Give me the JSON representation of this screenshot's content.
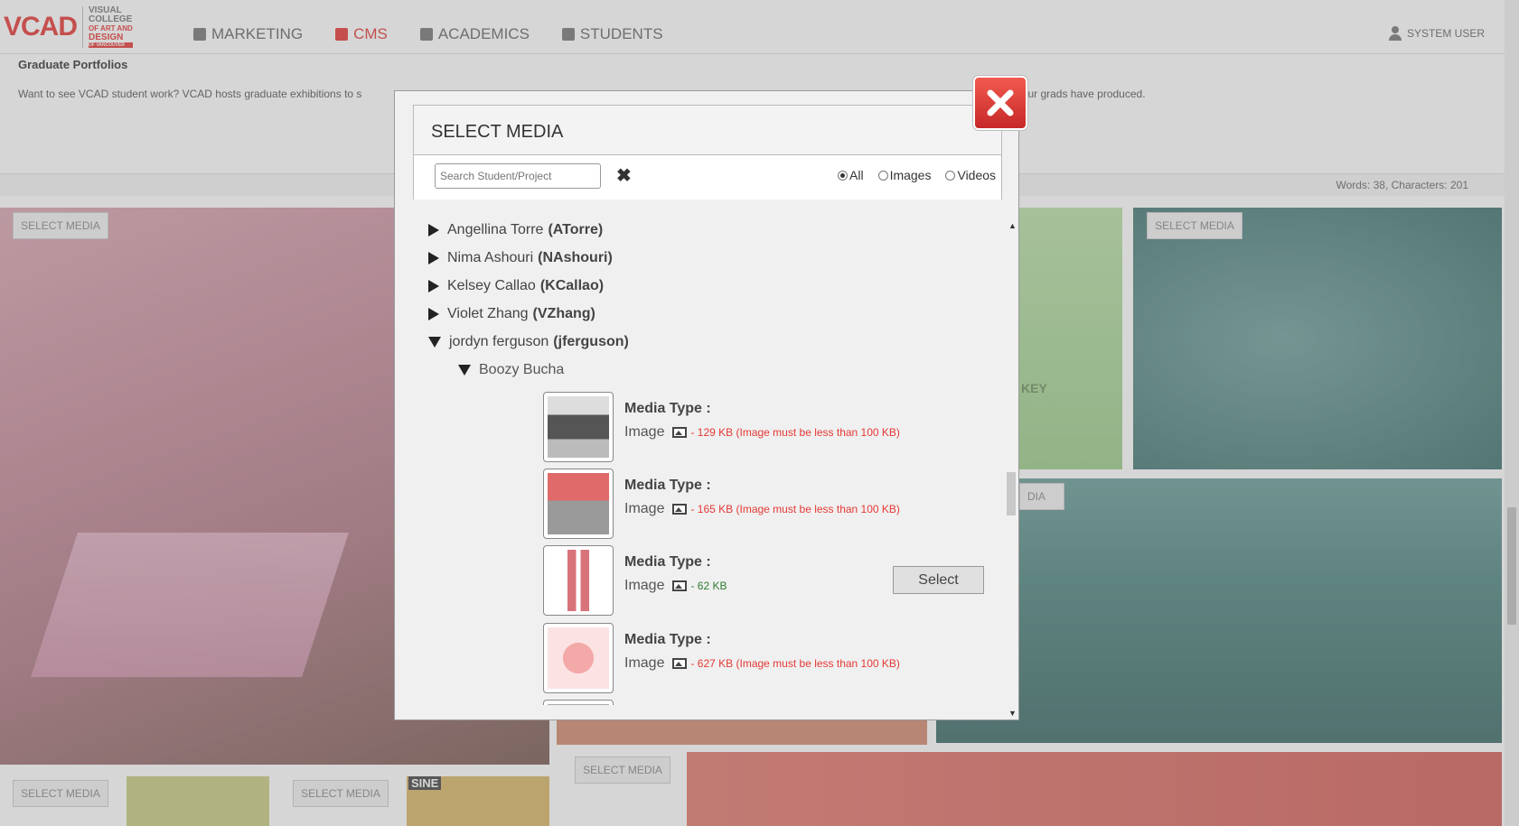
{
  "brand": {
    "mark": "VCAD",
    "lines": [
      "VISUAL",
      "COLLEGE",
      "OF ART AND",
      "DESIGN",
      "OF VANCOUVER"
    ]
  },
  "nav": [
    {
      "label": "MARKETING",
      "icon": "bar-chart-icon",
      "active": false
    },
    {
      "label": "CMS",
      "icon": "edit-icon",
      "active": true
    },
    {
      "label": "ACADEMICS",
      "icon": "classroom-icon",
      "active": false
    },
    {
      "label": "STUDENTS",
      "icon": "graduate-icon",
      "active": false
    }
  ],
  "user": {
    "label": "SYSTEM USER",
    "icon": "user-icon"
  },
  "page": {
    "section_title": "Graduate Portfolios",
    "description_left": "Want to see VCAD student work? VCAD hosts graduate exhibitions to s",
    "description_right": "work our grads have produced.",
    "word_count": "Words: 38, Characters: 201",
    "select_media_label": "SELECT MEDIA",
    "tile_labels": {
      "key_fragment": "KEY",
      "sine_fragment": "SINE",
      "dia_fragment": "DIA"
    }
  },
  "modal": {
    "title": "SELECT MEDIA",
    "search": {
      "placeholder": "Search Student/Project",
      "value": ""
    },
    "filters": [
      {
        "label": "All",
        "checked": true
      },
      {
        "label": "Images",
        "checked": false
      },
      {
        "label": "Videos",
        "checked": false
      }
    ],
    "students": [
      {
        "name": "Angellina Torre",
        "id": "(ATorre)",
        "expanded": false
      },
      {
        "name": "Nima Ashouri",
        "id": "(NAshouri)",
        "expanded": false
      },
      {
        "name": "Kelsey Callao",
        "id": "(KCallao)",
        "expanded": false
      },
      {
        "name": "Violet Zhang",
        "id": "(VZhang)",
        "expanded": false
      },
      {
        "name": "jordyn ferguson",
        "id": "(jferguson)",
        "expanded": true
      }
    ],
    "project": {
      "name": "Boozy Bucha",
      "expanded": true
    },
    "media_type_label": "Media Type :",
    "media": [
      {
        "type": "Image",
        "size": "- 129 KB (Image must be less than 100 KB)",
        "valid": false
      },
      {
        "type": "Image",
        "size": "- 165 KB (Image must be less than 100 KB)",
        "valid": false
      },
      {
        "type": "Image",
        "size": "- 62 KB",
        "valid": true,
        "action": "Select"
      },
      {
        "type": "Image",
        "size": "- 627 KB (Image must be less than 100 KB)",
        "valid": false
      },
      {
        "type": "",
        "size": "",
        "valid": false
      }
    ]
  }
}
